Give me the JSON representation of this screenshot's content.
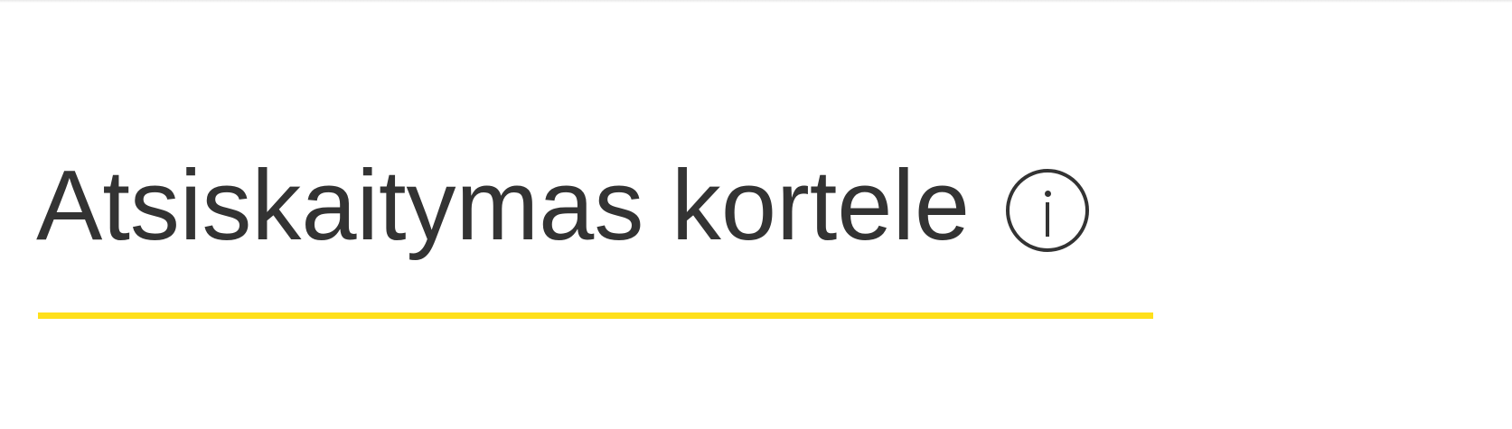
{
  "header": {
    "title": "Atsiskaitymas kortele",
    "info_icon": "info-circle-icon"
  },
  "colors": {
    "text": "#333333",
    "accent_underline": "#ffe01b",
    "background": "#ffffff"
  }
}
